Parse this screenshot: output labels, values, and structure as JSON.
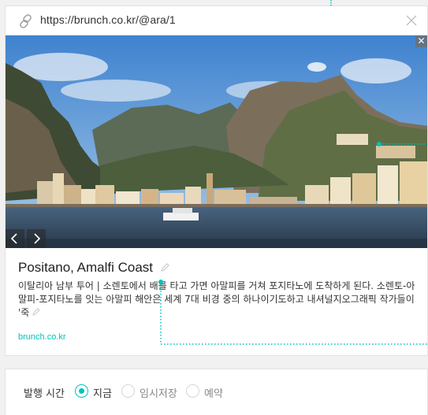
{
  "url_bar": {
    "url": "https://brunch.co.kr/@ara/1",
    "icons": {
      "link": "link-icon",
      "close": "close-icon"
    }
  },
  "image": {
    "alt_scene": "Positano coastline",
    "close_glyph": "✕",
    "nav": {
      "prev": "chevron-left-icon",
      "next": "chevron-right-icon"
    }
  },
  "article": {
    "title": "Positano, Amalfi Coast",
    "description": "이탈리아 남부 투어 | 소렌토에서 배를 타고 가면 아말피를 거쳐 포지타노에 도착하게 된다. 소렌토-아말피-포지타노를 잇는 아말피 해안은 세계 7대 비경 중의 하나이기도하고 내셔널지오그래픽 작가들이 '죽",
    "source": "brunch.co.kr"
  },
  "publish": {
    "label": "발행 시간",
    "options": [
      {
        "label": "지금",
        "selected": true
      },
      {
        "label": "임시저장",
        "selected": false
      },
      {
        "label": "예약",
        "selected": false
      }
    ]
  },
  "colors": {
    "accent": "#00c3bd",
    "text": "#333333",
    "muted": "#888888"
  }
}
